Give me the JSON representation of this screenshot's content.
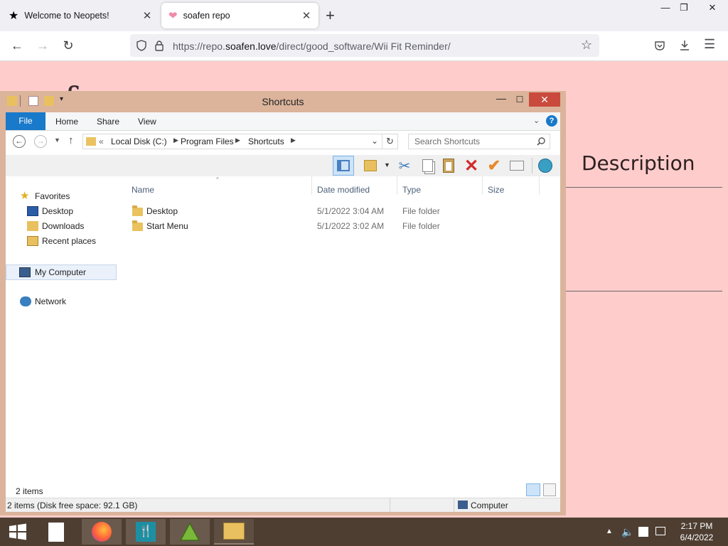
{
  "browser": {
    "tabs": [
      {
        "title": "Welcome to Neopets!",
        "active": false,
        "icon": "star-icon"
      },
      {
        "title": "soafen repo",
        "active": true,
        "icon": "heart-icon"
      }
    ],
    "window_controls": {
      "minimize": "—",
      "restore": "❐",
      "close": "✕"
    },
    "url_prefix": "https://repo.",
    "url_host": "soafen.love",
    "url_path": "/direct/good_software/Wii Fit Reminder/"
  },
  "page": {
    "title": "soafen repo",
    "description_header": "Description"
  },
  "explorer": {
    "title": "Shortcuts",
    "ribbon_tabs": [
      "File",
      "Home",
      "Share",
      "View"
    ],
    "breadcrumb": [
      "Local Disk (C:)",
      "Program Files",
      "Shortcuts"
    ],
    "search_placeholder": "Search Shortcuts",
    "nav": {
      "favorites": "Favorites",
      "desktop": "Desktop",
      "downloads": "Downloads",
      "recent": "Recent places",
      "my_computer": "My Computer",
      "network": "Network"
    },
    "columns": [
      "Name",
      "Date modified",
      "Type",
      "Size"
    ],
    "rows": [
      {
        "name": "Desktop",
        "date": "5/1/2022 3:04 AM",
        "type": "File folder",
        "size": ""
      },
      {
        "name": "Start Menu",
        "date": "5/1/2022 3:02 AM",
        "type": "File folder",
        "size": ""
      }
    ],
    "item_count": "2 items",
    "status_left": "2 items (Disk free space: 92.1 GB)",
    "status_right": "Computer"
  },
  "taskbar": {
    "time": "2:17 PM",
    "date": "6/4/2022"
  },
  "colors": {
    "page_bg": "#ffcccc",
    "explorer_frame": "#dbb49b",
    "file_tab": "#1979ca",
    "close_button": "#c94a3c",
    "taskbar": "#4e3e32"
  }
}
